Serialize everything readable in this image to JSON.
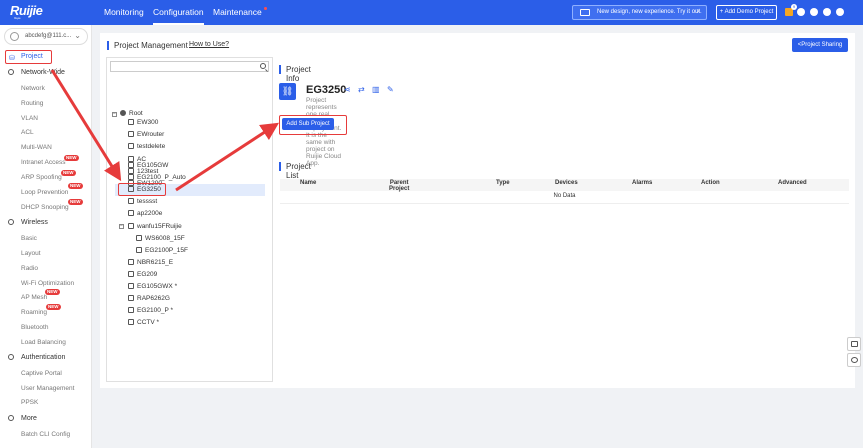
{
  "header": {
    "logo_text": "Ruijie",
    "logo_sub": "Reyee",
    "nav": [
      "Monitoring",
      "Configuration",
      "Maintenance"
    ],
    "promo": "New design, new experience. Try it out.",
    "promo_arrow": ">",
    "demo_button": "+ Add Demo Project",
    "notification_count": "9",
    "accent": "#2b5ee8"
  },
  "sidebar": {
    "account": "abcdefg@111.c...",
    "project": "Project",
    "network_wide": "Network-Wide",
    "network_items": [
      "Network",
      "Routing",
      "VLAN",
      "ACL",
      "Multi-WAN",
      "Intranet Access",
      "ARP Spoofing",
      "Loop Prevention",
      "DHCP Snooping"
    ],
    "wireless": "Wireless",
    "wireless_items": [
      "Basic",
      "Layout",
      "Radio",
      "Wi-Fi Optimization",
      "AP Mesh",
      "Roaming",
      "Bluetooth",
      "Load Balancing"
    ],
    "authentication": "Authentication",
    "auth_items": [
      "Captive Portal",
      "User Management",
      "PPSK"
    ],
    "more": "More",
    "more_items": [
      "Batch CLI Config"
    ],
    "new_label": "NEW"
  },
  "main": {
    "title": "Project Management",
    "how_to": "How to Use?",
    "share": "<Project Sharing",
    "search_placeholder": "",
    "tree": {
      "root": "Root",
      "nodes": [
        "EW300",
        "EWrouter",
        "testdelete",
        "AC",
        "123test",
        "EW1200",
        "EG105GW",
        "EG2100_P_Auto",
        "EG3250",
        "tesssst",
        "ap2200e",
        "wanfu15FRuijie",
        "WS6008_15F",
        "EG2100P_15F",
        "NBR6215_E",
        "EG209",
        "EG105GWX *",
        "RAP6262G",
        "EG2100_P *",
        "CCTV *"
      ]
    },
    "project_info": {
      "section": "Project Info",
      "name": "EG3250",
      "description": "Project represents one real network deployment. It is the same with project on Ruijie Cloud App.",
      "add_sub": "Add Sub Project"
    },
    "project_list": {
      "section": "Project List",
      "columns": [
        "Name",
        "Parent Project",
        "Type",
        "Devices",
        "Alarms",
        "Action",
        "Advanced"
      ],
      "empty": "No Data"
    }
  },
  "highlight_color": "#e63b3b"
}
